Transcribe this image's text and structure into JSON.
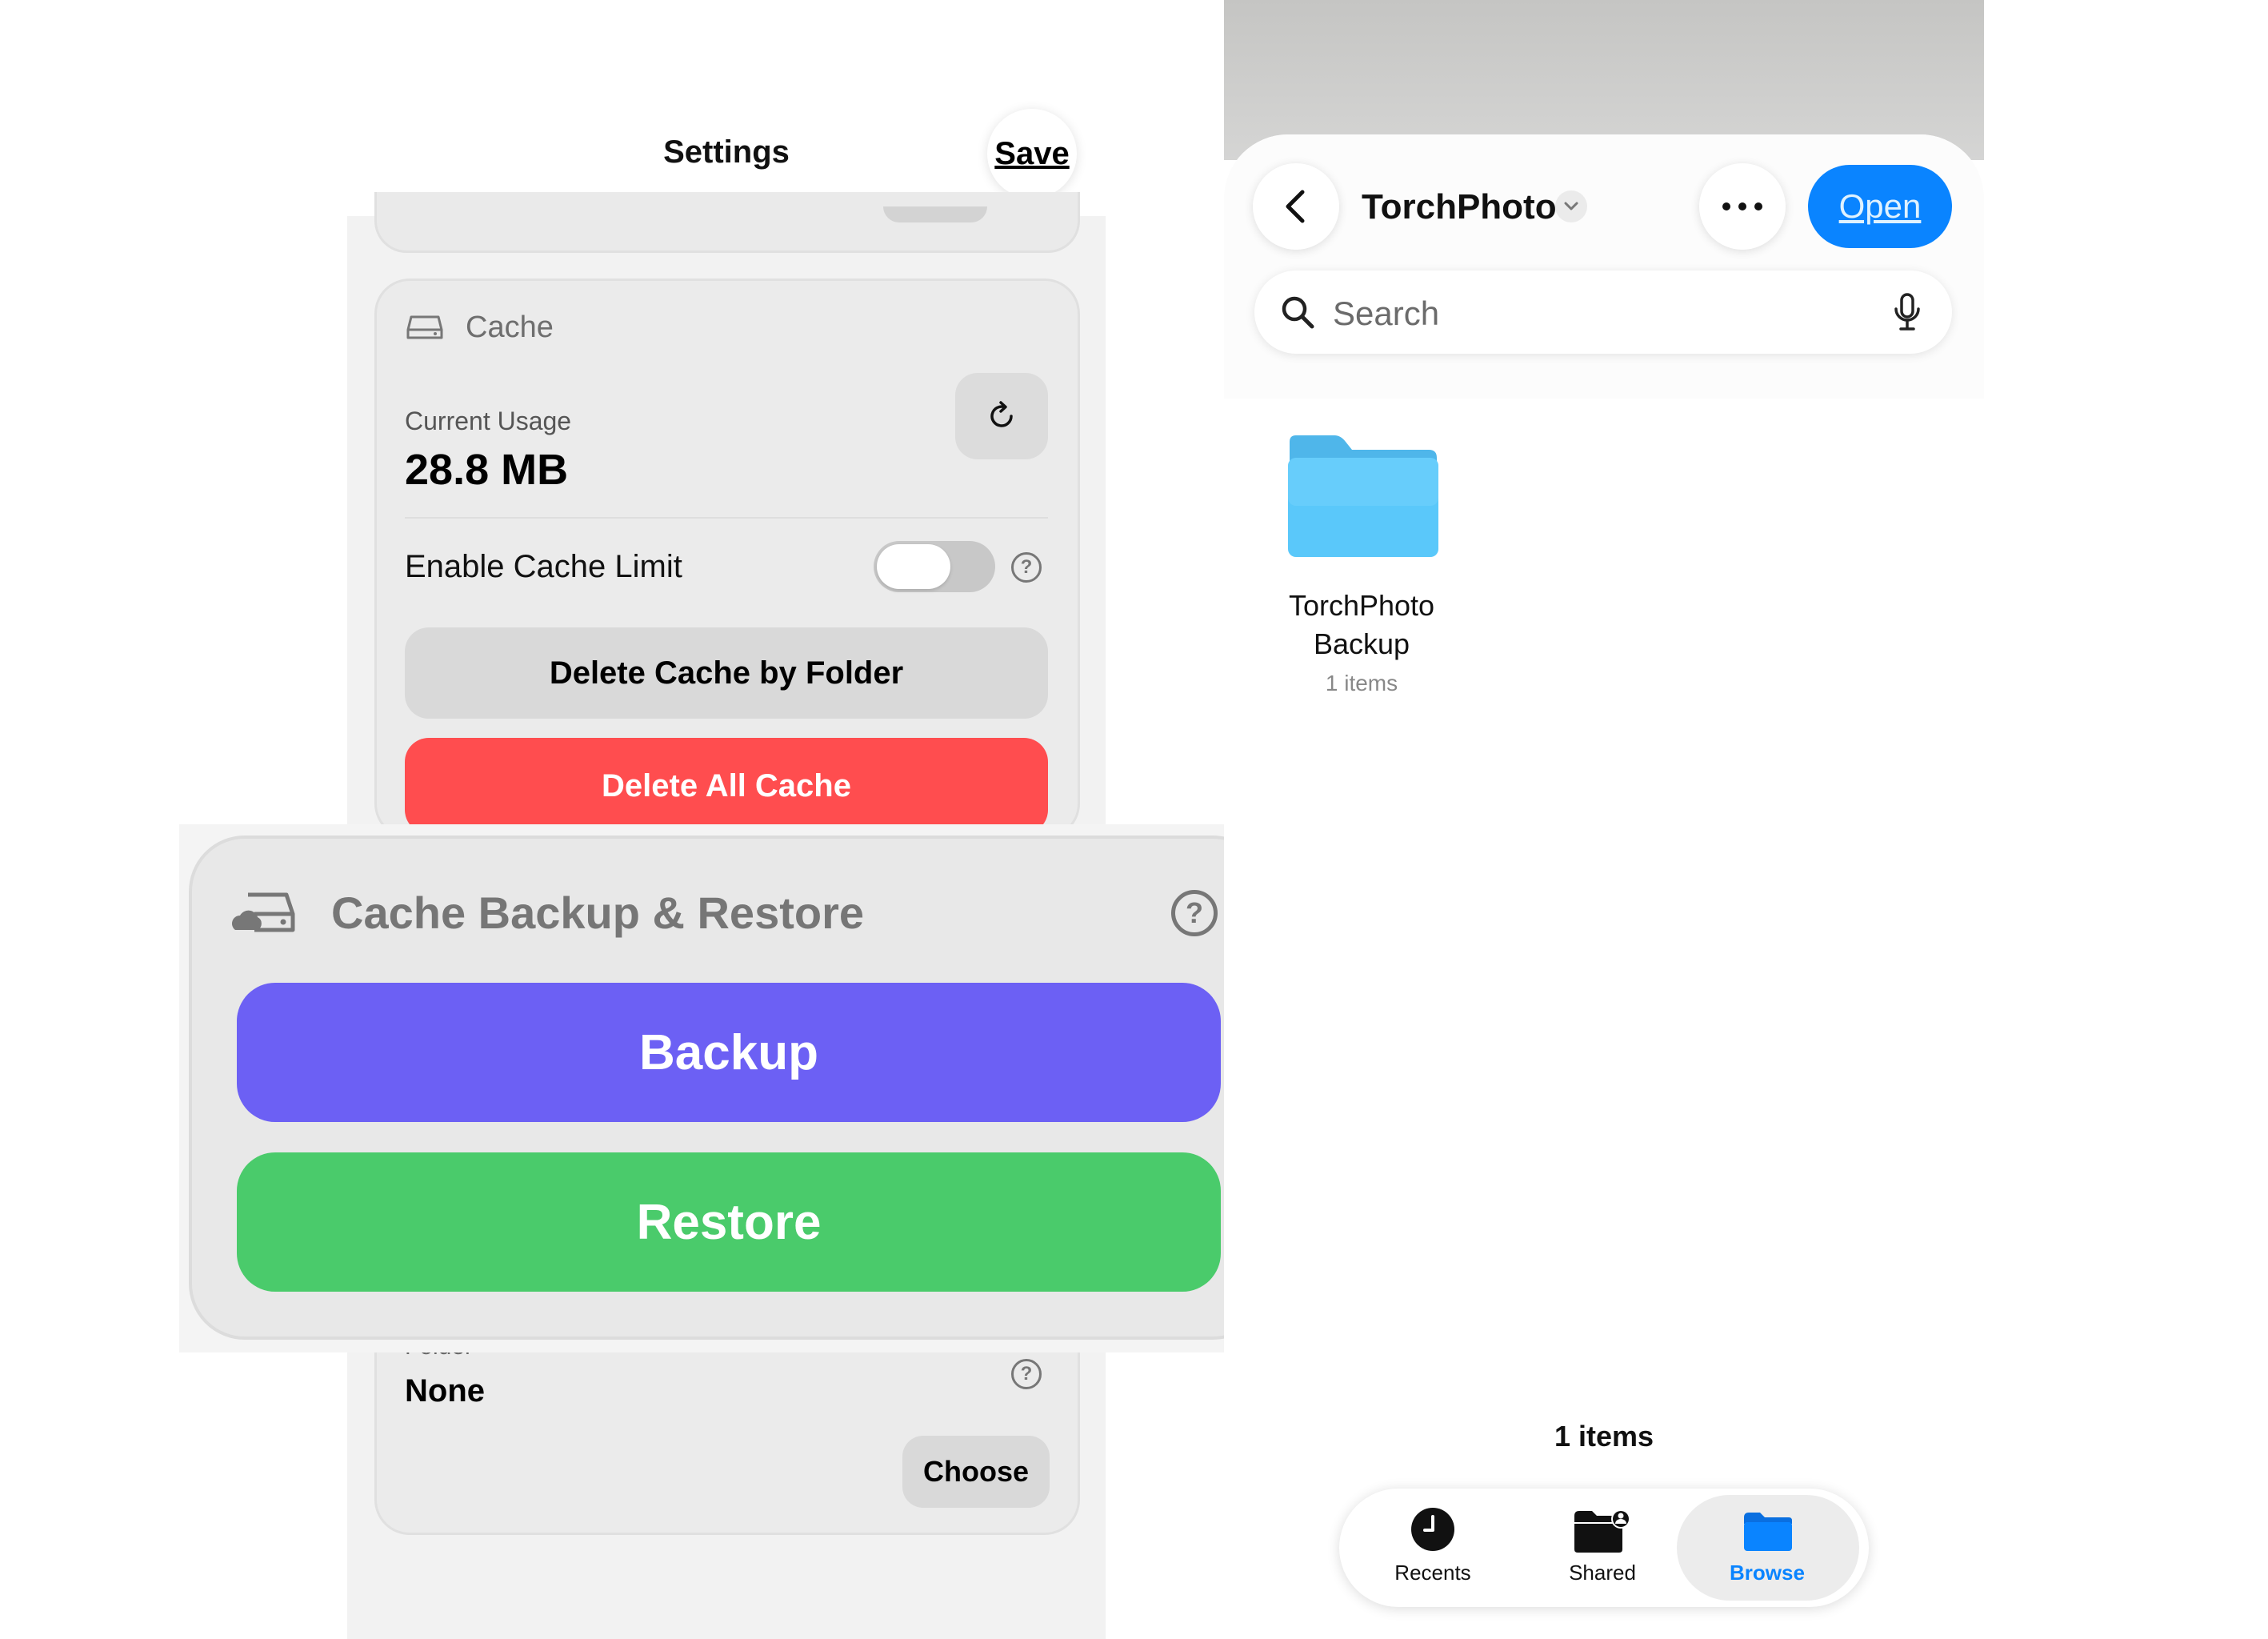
{
  "settings": {
    "title": "Settings",
    "save_label": "Save",
    "cache": {
      "title": "Cache",
      "icon": "drive-icon",
      "current_usage_label": "Current Usage",
      "current_usage_value": "28.8 MB",
      "refresh_icon": "refresh-icon",
      "enable_limit_label": "Enable Cache Limit",
      "enable_limit_on": false,
      "help_glyph": "?",
      "delete_by_folder_label": "Delete Cache by Folder",
      "delete_all_label": "Delete All Cache"
    },
    "folder": {
      "label": "Folder",
      "value": "None",
      "help_glyph": "?",
      "choose_label": "Choose"
    }
  },
  "backup_restore": {
    "title": "Cache Backup & Restore",
    "icon": "cloud-drive-icon",
    "help_glyph": "?",
    "backup_label": "Backup",
    "restore_label": "Restore",
    "colors": {
      "backup": "#6c60f4",
      "restore": "#4acb6b"
    }
  },
  "files": {
    "title": "TorchPhoto",
    "open_label": "Open",
    "search_placeholder": "Search",
    "folder": {
      "name_line1": "TorchPhoto",
      "name_line2": "Backup",
      "count": "1 items"
    },
    "items_count": "1 items",
    "tabs": [
      {
        "label": "Recents",
        "icon": "clock-icon",
        "selected": false
      },
      {
        "label": "Shared",
        "icon": "shared-folder-icon",
        "selected": false
      },
      {
        "label": "Browse",
        "icon": "folder-icon",
        "selected": true
      }
    ],
    "colors": {
      "accent": "#0a84ff",
      "folder": "#5ac8fa"
    }
  }
}
